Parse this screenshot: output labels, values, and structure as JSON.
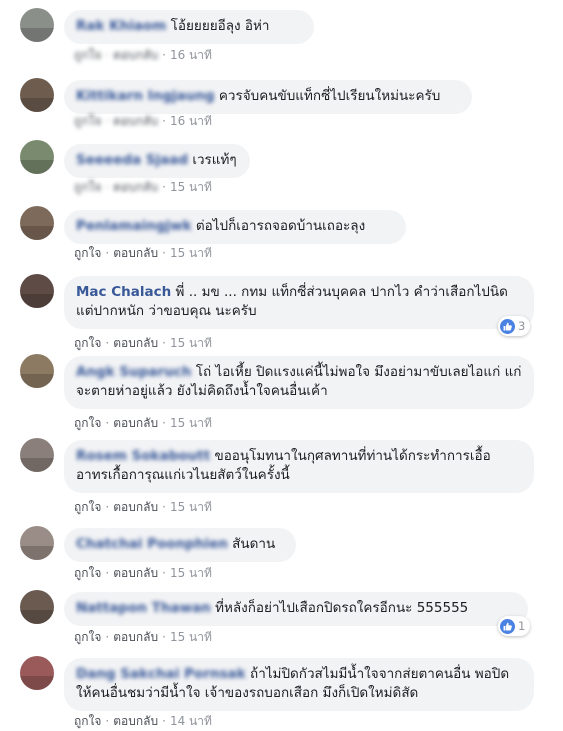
{
  "actions": {
    "like": "ถูกใจ",
    "reply": "ตอบกลับ",
    "dot": "·"
  },
  "comments": [
    {
      "name": "Rak Khiaom",
      "text": "โอ้ยยยยอีลุง อิห่า",
      "time": "16 นาที",
      "avatar_color": "#8b8f8a",
      "blur_actions": true
    },
    {
      "name": "Kittikarn Ingjaung",
      "text": "ควรจับคนขับแท็กซี่ไปเรียนใหม่นะครับ",
      "time": "16 นาที",
      "avatar_color": "#6e5d4f",
      "blur_actions": true
    },
    {
      "name": "Seeeeda Sjaad",
      "text": "เวรแท้ๆ",
      "time": "15 นาที",
      "avatar_color": "#7a8a6e",
      "blur_actions": true
    },
    {
      "name": "Penlamaingjwk",
      "text": "ต่อไปก็เอารถจอดบ้านเถอะลุง",
      "time": "15 นาที",
      "avatar_color": "#7e6a5a"
    },
    {
      "name": "Mac Chalach",
      "text": "พี่ .. มข ... กทม แท็กซี่ส่วนบุคคล ปากไว คำว่าเสือกไปนิด แต่ปากหนัก ว่าขอบคุณ นะครับ",
      "time": "15 นาที",
      "avatar_color": "#5e4b45",
      "reactions": "3"
    },
    {
      "name": "Angk Suparuch",
      "text": "โถ่ ไอเหี้ย ปิดแรงแค่นี้ไม่พอใจ มึงอย่ามาขับเลยไอแก่ แก่จะตายห่าอยู่แล้ว ยังไม่คิดถึงน้ำใจคนอื่นเค้า",
      "time": "15 นาที",
      "avatar_color": "#8c7a62"
    },
    {
      "name": "Rosem Sokaboutt",
      "text": "ขออนุโมทนาในกุศลทานที่ท่านได้กระทำการเอื้ออาทรเกื้อการุณแก่เวไนยสัตว์ในครั้งนี้",
      "time": "15 นาที",
      "avatar_color": "#8a7f7a"
    },
    {
      "name": "Chatchai Poonphien",
      "text": "สันดาน",
      "time": "15 นาที",
      "avatar_color": "#9a8c86"
    },
    {
      "name": "Nattapon Thawan",
      "text": "ที่หลังก็อย่าไปเสือกปิดรถใครอีกนะ 555555",
      "time": "15 นาที",
      "avatar_color": "#6a5a50",
      "reactions": "1"
    },
    {
      "name": "Dang Sakchai Pornsak",
      "text": "ถ้าไม่ปิดกัวสไมมีน้ำใจจากส่ยตาคนอื่น พอปิดให้คนอื่นชมว่ามีน้ำใจ เจ้าของรถบอกเสือก มึงก็เปิดใหม่ดิสัด",
      "time": "14 นาที",
      "avatar_color": "#9a5a5a"
    }
  ]
}
